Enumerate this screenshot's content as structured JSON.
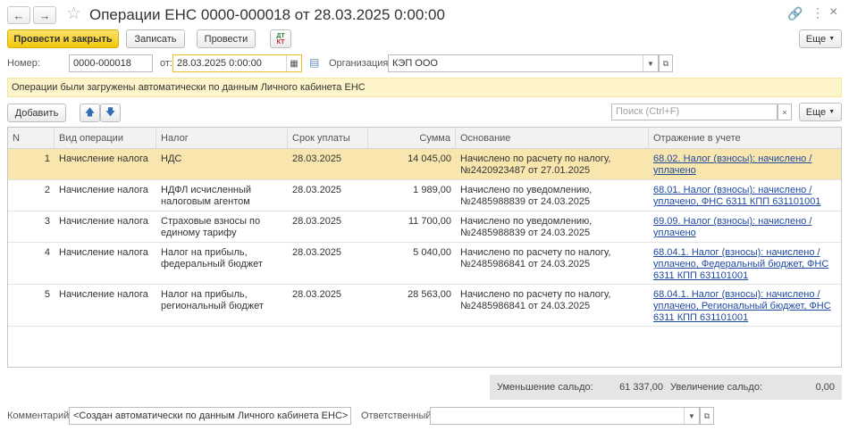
{
  "window": {
    "title": "Операции ЕНС 0000-000018 от 28.03.2025 0:00:00"
  },
  "toolbar": {
    "post_close_label": "Провести и закрыть",
    "save_label": "Записать",
    "post_label": "Провести",
    "dtkt_top": "ДТ",
    "dtkt_bottom": "КТ",
    "more_label": "Еще"
  },
  "form": {
    "number_label": "Номер:",
    "number_value": "0000-000018",
    "date_label": "от:",
    "date_value": "28.03.2025  0:00:00",
    "org_label": "Организация:",
    "org_value": "КЭП ООО"
  },
  "info_message": "Операции были загружены автоматически по данным Личного кабинета ЕНС",
  "table_toolbar": {
    "add_label": "Добавить",
    "search_placeholder": "Поиск (Ctrl+F)",
    "more_label": "Еще"
  },
  "table": {
    "columns": [
      "N",
      "Вид операции",
      "Налог",
      "Срок уплаты",
      "Сумма",
      "Основание",
      "Отражение в учете"
    ],
    "rows": [
      {
        "n": "1",
        "op": "Начисление налога",
        "tax": [
          "НДС"
        ],
        "due": "28.03.2025",
        "sum": "14 045,00",
        "basis": [
          "Начислено по расчету по налогу,",
          "№2420923487 от 27.01.2025"
        ],
        "account": [
          "68.02. Налог (взносы): начислено /",
          "уплачено"
        ]
      },
      {
        "n": "2",
        "op": "Начисление налога",
        "tax": [
          "НДФЛ исчисленный",
          "налоговым агентом"
        ],
        "due": "28.03.2025",
        "sum": "1 989,00",
        "basis": [
          "Начислено по уведомлению,",
          "№2485988839 от 24.03.2025"
        ],
        "account": [
          "68.01. Налог (взносы): начислено /",
          "уплачено, ФНС 6311 КПП 631101001"
        ]
      },
      {
        "n": "3",
        "op": "Начисление налога",
        "tax": [
          "Страховые взносы по",
          "единому тарифу"
        ],
        "due": "28.03.2025",
        "sum": "11 700,00",
        "basis": [
          "Начислено по уведомлению,",
          "№2485988839 от 24.03.2025"
        ],
        "account": [
          "69.09. Налог (взносы): начислено /",
          "уплачено"
        ]
      },
      {
        "n": "4",
        "op": "Начисление налога",
        "tax": [
          "Налог на прибыль,",
          "федеральный бюджет"
        ],
        "due": "28.03.2025",
        "sum": "5 040,00",
        "basis": [
          "Начислено по расчету по налогу,",
          "№2485986841 от 24.03.2025"
        ],
        "account": [
          "68.04.1. Налог (взносы): начислено /",
          "уплачено, Федеральный бюджет, ФНС",
          "6311 КПП 631101001"
        ]
      },
      {
        "n": "5",
        "op": "Начисление налога",
        "tax": [
          "Налог на прибыль,",
          "региональный бюджет"
        ],
        "due": "28.03.2025",
        "sum": "28 563,00",
        "basis": [
          "Начислено по расчету по налогу,",
          "№2485986841 от 24.03.2025"
        ],
        "account": [
          "68.04.1. Налог (взносы): начислено /",
          "уплачено, Региональный бюджет, ФНС",
          "6311 КПП 631101001"
        ]
      }
    ]
  },
  "totals": {
    "decrease_label": "Уменьшение сальдо:",
    "decrease_value": "61 337,00",
    "increase_label": "Увеличение сальдо:",
    "increase_value": "0,00"
  },
  "footer": {
    "comment_label": "Комментарий:",
    "comment_value": "<Создан автоматически по данным Личного кабинета ЕНС>",
    "responsible_label": "Ответственный:",
    "responsible_value": ""
  },
  "colors": {
    "primary_button": "#f2c80c",
    "selected_row": "#f9e6ae",
    "info_bar": "#fdf5c9",
    "link": "#1f4aa0"
  }
}
